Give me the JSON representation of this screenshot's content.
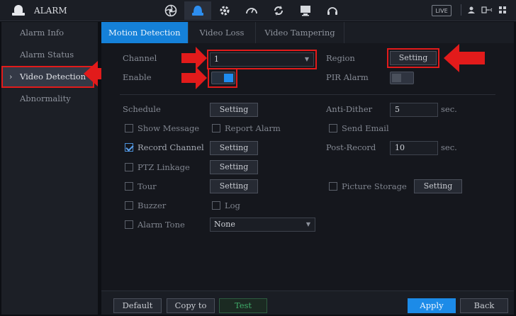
{
  "app": {
    "title": "ALARM",
    "live_label": "LIVE"
  },
  "top_icons": [
    "camera-lens-icon",
    "alarm-bell-icon",
    "settings-gear-icon",
    "performance-gauge-icon",
    "sync-refresh-icon",
    "monitor-icon",
    "headset-icon"
  ],
  "sidebar": {
    "items": [
      {
        "label": "Alarm Info",
        "active": false
      },
      {
        "label": "Alarm Status",
        "active": false
      },
      {
        "label": "Video Detection",
        "active": true
      },
      {
        "label": "Abnormality",
        "active": false
      }
    ],
    "chevron": "›"
  },
  "tabs": [
    {
      "label": "Motion Detection",
      "active": true
    },
    {
      "label": "Video Loss",
      "active": false
    },
    {
      "label": "Video Tampering",
      "active": false
    }
  ],
  "form": {
    "channel_label": "Channel",
    "channel_value": "1",
    "enable_label": "Enable",
    "enable_on": true,
    "region_label": "Region",
    "region_button": "Setting",
    "pir_label": "PIR Alarm",
    "pir_on": false,
    "schedule_label": "Schedule",
    "schedule_button": "Setting",
    "anti_dither_label": "Anti-Dither",
    "anti_dither_value": "5",
    "anti_dither_unit": "sec.",
    "show_message_label": "Show Message",
    "report_alarm_label": "Report Alarm",
    "send_email_label": "Send Email",
    "record_channel_label": "Record Channel",
    "record_channel_checked": true,
    "record_channel_button": "Setting",
    "post_record_label": "Post-Record",
    "post_record_value": "10",
    "post_record_unit": "sec.",
    "ptz_linkage_label": "PTZ Linkage",
    "ptz_linkage_button": "Setting",
    "tour_label": "Tour",
    "tour_button": "Setting",
    "picture_storage_label": "Picture Storage",
    "picture_storage_button": "Setting",
    "buzzer_label": "Buzzer",
    "log_label": "Log",
    "alarm_tone_label": "Alarm Tone",
    "alarm_tone_value": "None"
  },
  "bottom": {
    "default_label": "Default",
    "copy_to_label": "Copy to",
    "test_label": "Test",
    "apply_label": "Apply",
    "back_label": "Back"
  },
  "colors": {
    "accent": "#1c8be8",
    "highlight": "#e21b1b",
    "test": "#3fae6a"
  }
}
